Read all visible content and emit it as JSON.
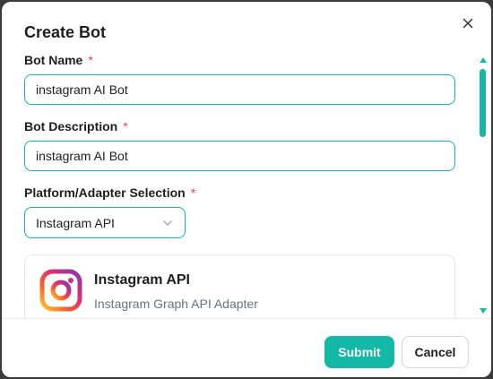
{
  "dialog": {
    "title": "Create Bot"
  },
  "form": {
    "bot_name": {
      "label": "Bot Name",
      "required_mark": "*",
      "value": "instagram AI Bot"
    },
    "bot_description": {
      "label": "Bot Description",
      "required_mark": "*",
      "value": "instagram AI Bot"
    },
    "platform": {
      "label": "Platform/Adapter Selection",
      "required_mark": "*",
      "selected": "Instagram API"
    }
  },
  "platform_card": {
    "icon": "instagram-logo",
    "title": "Instagram API",
    "subtitle": "Instagram Graph API Adapter"
  },
  "footer": {
    "submit_label": "Submit",
    "cancel_label": "Cancel"
  },
  "colors": {
    "accent": "#14b8a6",
    "required": "#e5484d"
  }
}
